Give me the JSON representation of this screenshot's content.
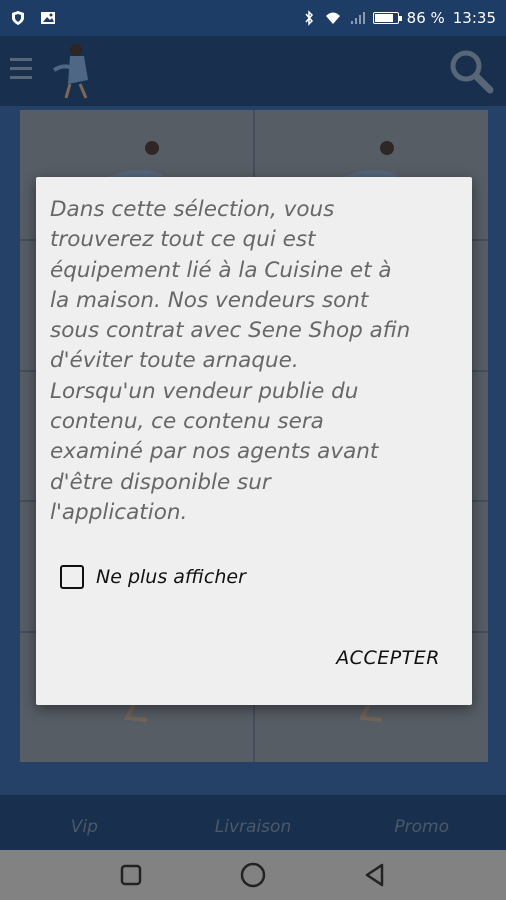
{
  "status_bar": {
    "battery_text": "86 %",
    "battery_level": 0.86,
    "time": "13:35",
    "icons": [
      "shield-icon",
      "image-icon",
      "bluetooth-icon",
      "wifi-icon",
      "signal-icon",
      "battery-icon"
    ]
  },
  "app_bar": {
    "icons": [
      "menu-icon",
      "logo",
      "search-icon"
    ]
  },
  "bottom_nav": {
    "items": [
      {
        "label": "Vip"
      },
      {
        "label": "Livraison"
      },
      {
        "label": "Promo"
      }
    ]
  },
  "dialog": {
    "message_lines": [
      "Dans cette sélection, vous",
      "trouverez tout ce qui est",
      "équipement lié à la Cuisine et à",
      "la maison. Nos vendeurs sont",
      "sous contrat avec Sene Shop afin",
      "d'éviter toute arnaque.",
      "Lorsqu'un vendeur publie du",
      "contenu, ce contenu sera",
      "examiné par nos agents avant",
      "d'être disponible sur",
      "l'application."
    ],
    "checkbox_label": "Ne plus afficher",
    "checkbox_checked": false,
    "accept_label": "ACCEPTER"
  },
  "system_nav": {
    "icons": [
      "recents-icon",
      "home-icon",
      "back-icon"
    ]
  },
  "colors": {
    "status_bar": "#1d3d66",
    "app_bar": "#274c7c",
    "dialog_bg": "#efefef",
    "dialog_text": "#676767",
    "system_nav": "#828282"
  }
}
